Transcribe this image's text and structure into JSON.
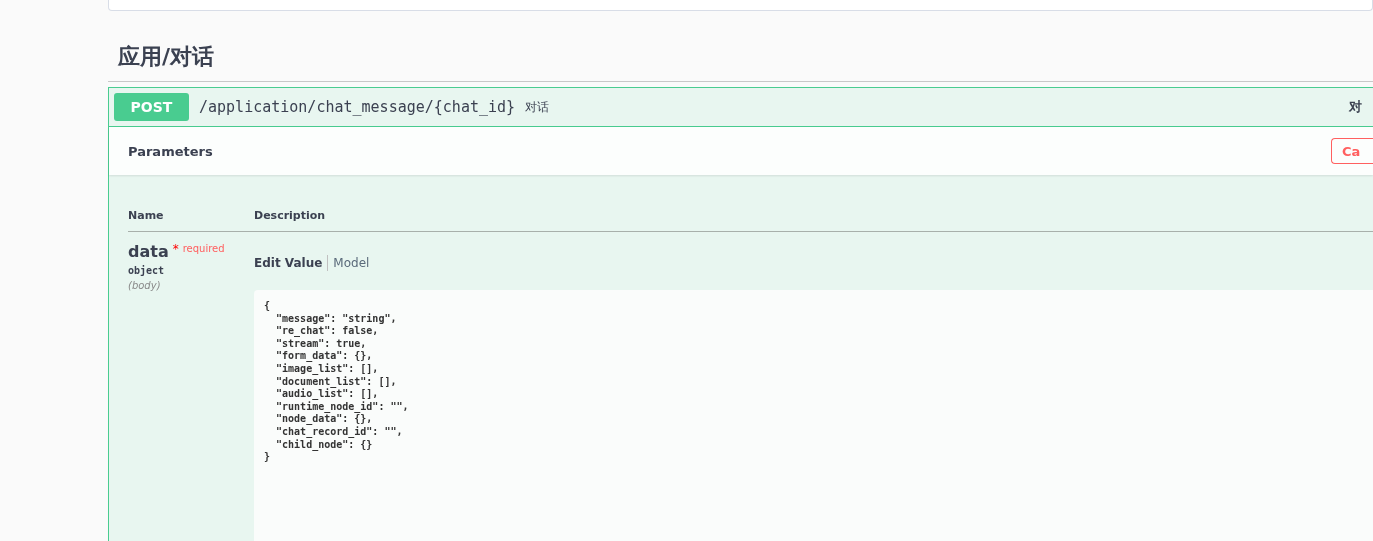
{
  "section": {
    "title": "应用/对话"
  },
  "operation": {
    "method": "POST",
    "path": "/application/chat_message/{chat_id}",
    "description": "对话",
    "summary_right": "对",
    "expanded": true
  },
  "parameters_header": {
    "title": "Parameters",
    "cancel_button": "Ca"
  },
  "table": {
    "columns": [
      "Name",
      "Description"
    ],
    "rows": [
      {
        "name": "data",
        "required_mark": "*",
        "required_label": "required",
        "type": "object",
        "location": "(body)",
        "tabs": [
          {
            "label": "Edit Value",
            "selected": true
          },
          {
            "label": "Model",
            "selected": false
          }
        ],
        "value": "{\n  \"message\": \"string\",\n  \"re_chat\": false,\n  \"stream\": true,\n  \"form_data\": {},\n  \"image_list\": [],\n  \"document_list\": [],\n  \"audio_list\": [],\n  \"runtime_node_id\": \"\",\n  \"node_data\": {},\n  \"chat_record_id\": \"\",\n  \"child_node\": {}\n}"
      }
    ]
  }
}
